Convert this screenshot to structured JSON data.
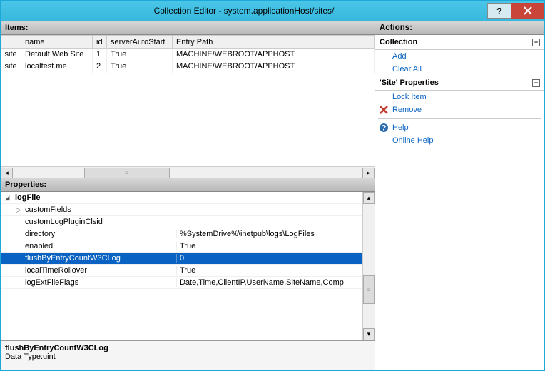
{
  "titlebar": {
    "title": "Collection Editor - system.applicationHost/sites/"
  },
  "items": {
    "heading": "Items:",
    "columns": {
      "c0": "",
      "c1": "name",
      "c2": "id",
      "c3": "serverAutoStart",
      "c4": "Entry Path"
    },
    "rows": [
      {
        "c0": "site",
        "c1": "Default Web Site",
        "c2": "1",
        "c3": "True",
        "c4": "MACHINE/WEBROOT/APPHOST"
      },
      {
        "c0": "site",
        "c1": "localtest.me",
        "c2": "2",
        "c3": "True",
        "c4": "MACHINE/WEBROOT/APPHOST"
      }
    ]
  },
  "properties": {
    "heading": "Properties:",
    "rows": [
      {
        "indent": 0,
        "tri": "◢",
        "name": "logFile",
        "value": ""
      },
      {
        "indent": 1,
        "tri": "▷",
        "name": "customFields",
        "value": ""
      },
      {
        "indent": 1,
        "tri": "",
        "name": "customLogPluginClsid",
        "value": ""
      },
      {
        "indent": 1,
        "tri": "",
        "name": "directory",
        "value": "%SystemDrive%\\inetpub\\logs\\LogFiles"
      },
      {
        "indent": 1,
        "tri": "",
        "name": "enabled",
        "value": "True"
      },
      {
        "indent": 1,
        "tri": "",
        "name": "flushByEntryCountW3CLog",
        "value": "0",
        "selected": true
      },
      {
        "indent": 1,
        "tri": "",
        "name": "localTimeRollover",
        "value": "True"
      },
      {
        "indent": 1,
        "tri": "",
        "name": "logExtFileFlags",
        "value": "Date,Time,ClientIP,UserName,SiteName,Comp"
      }
    ],
    "desc": {
      "name": "flushByEntryCountW3CLog",
      "type": "Data Type:uint"
    }
  },
  "actions": {
    "heading": "Actions:",
    "collection": {
      "title": "Collection",
      "add": "Add",
      "clear": "Clear All"
    },
    "siteprops": {
      "title": "'Site' Properties",
      "lock": "Lock Item",
      "remove": "Remove"
    },
    "help": {
      "help": "Help",
      "online": "Online Help"
    }
  }
}
